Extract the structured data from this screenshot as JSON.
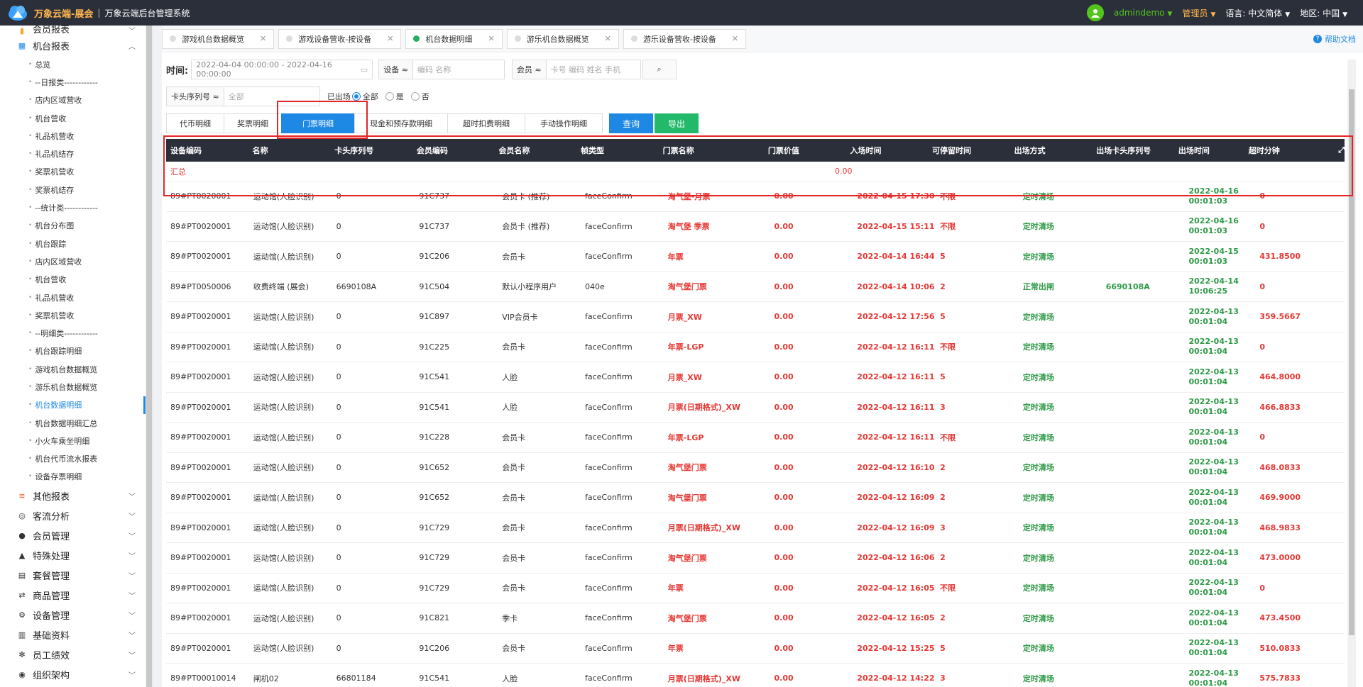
{
  "topbar": {
    "brand": "万象云端-展会",
    "sep": "|",
    "subtitle": "万象云端后台管理系统",
    "username": "admindemo",
    "role": "管理员",
    "language_label": "语言:",
    "language_value": "中文简体",
    "region_label": "地区:",
    "region_value": "中国",
    "accent": "#ffb64d"
  },
  "sidebar": {
    "groups_top": [
      {
        "label": "会员报表",
        "icon": "chart-icon",
        "chev": "⌄"
      },
      {
        "label": "机台报表",
        "icon": "grid-icon",
        "chev": "⌃"
      }
    ],
    "items": [
      "总览",
      "--日报类------------",
      "店内区域营收",
      "机台营收",
      "礼品机营收",
      "礼品机结存",
      "奖票机营收",
      "奖票机结存",
      "--统计类------------",
      "机台分布图",
      "机台跟踪",
      "店内区域营收",
      "机台营收",
      "礼品机营收",
      "奖票机营收",
      "--明细类------------",
      "机台跟踪明细",
      "游戏机台数据概览",
      "游乐机台数据概览",
      "机台数据明细",
      "机台数据明细汇总",
      "小火车乘坐明细",
      "机台代币流水报表",
      "设备存票明细"
    ],
    "active_item": "机台数据明细",
    "groups_bottom": [
      {
        "label": "其他报表",
        "icon": "layers-icon"
      },
      {
        "label": "客流分析",
        "icon": "target-icon"
      },
      {
        "label": "会员管理",
        "icon": "user-icon"
      },
      {
        "label": "特殊处理",
        "icon": "warning-icon"
      },
      {
        "label": "套餐管理",
        "icon": "package-icon"
      },
      {
        "label": "商品管理",
        "icon": "swap-icon"
      },
      {
        "label": "设备管理",
        "icon": "device-icon"
      },
      {
        "label": "基础资料",
        "icon": "book-icon"
      },
      {
        "label": "员工绩效",
        "icon": "gear-icon"
      },
      {
        "label": "组织架构",
        "icon": "org-icon"
      }
    ]
  },
  "page_tabs": [
    {
      "label": "游戏机台数据概览",
      "active": false
    },
    {
      "label": "游戏设备营收-按设备",
      "active": false
    },
    {
      "label": "机台数据明细",
      "active": true
    },
    {
      "label": "游乐机台数据概览",
      "active": false
    },
    {
      "label": "游乐设备营收-按设备",
      "active": false
    }
  ],
  "help_label": "帮助文档",
  "filters": {
    "time_label": "时间:",
    "time_value": "2022-04-04 00:00:00 - 2022-04-16 00:00:00",
    "device_sel": "设备 ≈",
    "device_placeholder": "编码 名称",
    "member_sel": "会员 ≈",
    "member_placeholder": "卡号 编码 姓名 手机",
    "search_icon": "search-icon",
    "card_sel": "卡头序列号 ≈",
    "card_placeholder": "全部",
    "exit_label": "已出场",
    "radio_all": "全部",
    "radio_yes": "是",
    "radio_no": "否"
  },
  "subtabs": [
    "代币明细",
    "奖票明细",
    "门票明细",
    "现金和预存款明细",
    "超时扣费明细",
    "手动操作明细"
  ],
  "active_subtab": "门票明细",
  "buttons": {
    "query": "查询",
    "export": "导出"
  },
  "table": {
    "headers": [
      "设备编码",
      "名称",
      "卡头序列号",
      "会员编码",
      "会员名称",
      "帧类型",
      "门票名称",
      "门票价值",
      "入场时间",
      "可停留时间",
      "出场方式",
      "出场卡头序列号",
      "出场时间",
      "超时分钟"
    ],
    "summary": {
      "label": "汇总",
      "value": "0.00"
    },
    "rows": [
      [
        "89#PT0020001",
        "运动馆(人脸识别)",
        "0",
        "91C737",
        "会员卡 (推荐)",
        "faceConfirm",
        "淘气堡-月票",
        "0.00",
        "2022-04-15 17:30",
        "不限",
        "定时清场",
        "",
        "2022-04-16 00:01:03",
        "0"
      ],
      [
        "89#PT0020001",
        "运动馆(人脸识别)",
        "0",
        "91C737",
        "会员卡 (推荐)",
        "faceConfirm",
        "淘气堡 季票",
        "0.00",
        "2022-04-15 15:11",
        "不限",
        "定时清场",
        "",
        "2022-04-16 00:01:03",
        "0"
      ],
      [
        "89#PT0020001",
        "运动馆(人脸识别)",
        "0",
        "91C206",
        "会员卡",
        "faceConfirm",
        "年票",
        "0.00",
        "2022-04-14 16:44",
        "5",
        "定时清场",
        "",
        "2022-04-15 00:01:03",
        "431.8500"
      ],
      [
        "89#PT0050006",
        "收费终端 (展会)",
        "6690108A",
        "91C504",
        "默认小程序用户",
        "040e",
        "淘气堡门票",
        "0.00",
        "2022-04-14 10:06",
        "2",
        "正常出闸",
        "6690108A",
        "2022-04-14 10:06:25",
        "0"
      ],
      [
        "89#PT0020001",
        "运动馆(人脸识别)",
        "0",
        "91C897",
        "VIP会员卡",
        "faceConfirm",
        "月票_XW",
        "0.00",
        "2022-04-12 17:56",
        "5",
        "定时清场",
        "",
        "2022-04-13 00:01:04",
        "359.5667"
      ],
      [
        "89#PT0020001",
        "运动馆(人脸识别)",
        "0",
        "91C225",
        "会员卡",
        "faceConfirm",
        "年票-LGP",
        "0.00",
        "2022-04-12 16:11",
        "不限",
        "定时清场",
        "",
        "2022-04-13 00:01:04",
        "0"
      ],
      [
        "89#PT0020001",
        "运动馆(人脸识别)",
        "0",
        "91C541",
        "人脸",
        "faceConfirm",
        "月票_XW",
        "0.00",
        "2022-04-12 16:11",
        "5",
        "定时清场",
        "",
        "2022-04-13 00:01:04",
        "464.8000"
      ],
      [
        "89#PT0020001",
        "运动馆(人脸识别)",
        "0",
        "91C541",
        "人脸",
        "faceConfirm",
        "月票(日期格式)_XW",
        "0.00",
        "2022-04-12 16:11",
        "3",
        "定时清场",
        "",
        "2022-04-13 00:01:04",
        "466.8833"
      ],
      [
        "89#PT0020001",
        "运动馆(人脸识别)",
        "0",
        "91C228",
        "会员卡",
        "faceConfirm",
        "年票-LGP",
        "0.00",
        "2022-04-12 16:11",
        "不限",
        "定时清场",
        "",
        "2022-04-13 00:01:04",
        "0"
      ],
      [
        "89#PT0020001",
        "运动馆(人脸识别)",
        "0",
        "91C652",
        "会员卡",
        "faceConfirm",
        "淘气堡门票",
        "0.00",
        "2022-04-12 16:10",
        "2",
        "定时清场",
        "",
        "2022-04-13 00:01:04",
        "468.0833"
      ],
      [
        "89#PT0020001",
        "运动馆(人脸识别)",
        "0",
        "91C652",
        "会员卡",
        "faceConfirm",
        "淘气堡门票",
        "0.00",
        "2022-04-12 16:09",
        "2",
        "定时清场",
        "",
        "2022-04-13 00:01:04",
        "469.9000"
      ],
      [
        "89#PT0020001",
        "运动馆(人脸识别)",
        "0",
        "91C729",
        "会员卡",
        "faceConfirm",
        "月票(日期格式)_XW",
        "0.00",
        "2022-04-12 16:09",
        "3",
        "定时清场",
        "",
        "2022-04-13 00:01:04",
        "468.9833"
      ],
      [
        "89#PT0020001",
        "运动馆(人脸识别)",
        "0",
        "91C729",
        "会员卡",
        "faceConfirm",
        "淘气堡门票",
        "0.00",
        "2022-04-12 16:06",
        "2",
        "定时清场",
        "",
        "2022-04-13 00:01:04",
        "473.0000"
      ],
      [
        "89#PT0020001",
        "运动馆(人脸识别)",
        "0",
        "91C729",
        "会员卡",
        "faceConfirm",
        "年票",
        "0.00",
        "2022-04-12 16:05",
        "不限",
        "定时清场",
        "",
        "2022-04-13 00:01:04",
        "0"
      ],
      [
        "89#PT0020001",
        "运动馆(人脸识别)",
        "0",
        "91C821",
        "季卡",
        "faceConfirm",
        "淘气堡门票",
        "0.00",
        "2022-04-12 16:05",
        "2",
        "定时清场",
        "",
        "2022-04-13 00:01:04",
        "473.4500"
      ],
      [
        "89#PT0020001",
        "运动馆(人脸识别)",
        "0",
        "91C206",
        "会员卡",
        "faceConfirm",
        "年票",
        "0.00",
        "2022-04-12 15:25",
        "5",
        "定时清场",
        "",
        "2022-04-13 00:01:04",
        "510.0833"
      ],
      [
        "89#PT00010014",
        "闸机02",
        "66801184",
        "91C541",
        "人脸",
        "faceConfirm",
        "月票(日期格式)_XW",
        "0.00",
        "2022-04-12 14:22",
        "3",
        "定时清场",
        "",
        "2022-04-13 00:01:04",
        "575.7833"
      ]
    ]
  },
  "colors": {
    "red": "#e53935",
    "green": "#2e9a47",
    "primary": "#1e88e5",
    "header_bg": "#2b2f3a"
  }
}
